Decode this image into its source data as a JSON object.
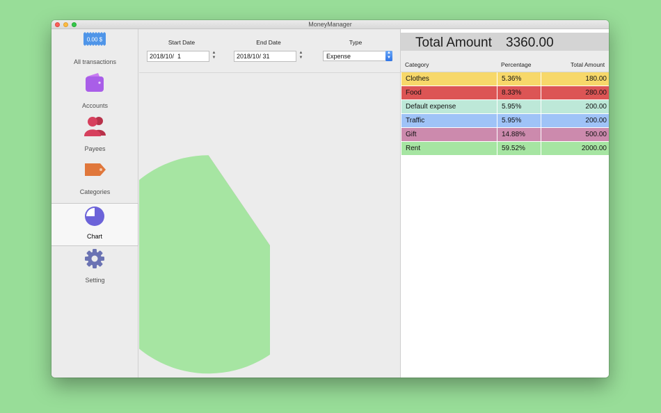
{
  "window": {
    "title": "MoneyManager"
  },
  "sidebar": {
    "badge_text": "0.00 $",
    "items": [
      {
        "label": "All transactions",
        "icon": "receipt-icon"
      },
      {
        "label": "Accounts",
        "icon": "wallet-icon"
      },
      {
        "label": "Payees",
        "icon": "people-icon"
      },
      {
        "label": "Categories",
        "icon": "tag-icon"
      },
      {
        "label": "Chart",
        "icon": "pie-chart-icon",
        "selected": true
      },
      {
        "label": "Setting",
        "icon": "gear-icon"
      }
    ]
  },
  "filters": {
    "start_label": "Start Date",
    "start_value": "2018/10/  1",
    "end_label": "End Date",
    "end_value": "2018/10/ 31",
    "type_label": "Type",
    "type_value": "Expense"
  },
  "summary": {
    "label": "Total Amount",
    "value": "3360.00"
  },
  "table": {
    "headers": {
      "category": "Category",
      "percentage": "Percentage",
      "amount": "Total Amount"
    },
    "rows": [
      {
        "category": "Clothes",
        "percentage": "5.36%",
        "amount": "180.00",
        "color": "#f7d86a"
      },
      {
        "category": "Food",
        "percentage": "8.33%",
        "amount": "280.00",
        "color": "#dc5555"
      },
      {
        "category": "Default expense",
        "percentage": "5.95%",
        "amount": "200.00",
        "color": "#bde8d8"
      },
      {
        "category": "Traffic",
        "percentage": "5.95%",
        "amount": "200.00",
        "color": "#9fc3f7"
      },
      {
        "category": "Gift",
        "percentage": "14.88%",
        "amount": "500.00",
        "color": "#cc8aad"
      },
      {
        "category": "Rent",
        "percentage": "59.52%",
        "amount": "2000.00",
        "color": "#a6e5a2"
      }
    ]
  },
  "chart_data": {
    "type": "pie",
    "categories": [
      "Clothes",
      "Food",
      "Default expense",
      "Traffic",
      "Gift",
      "Rent"
    ],
    "values": [
      180,
      280,
      200,
      200,
      500,
      2000
    ],
    "colors": [
      "#f7d86a",
      "#dc5555",
      "#bde8d8",
      "#9fc3f7",
      "#cc8aad",
      "#a6e5a2"
    ]
  }
}
